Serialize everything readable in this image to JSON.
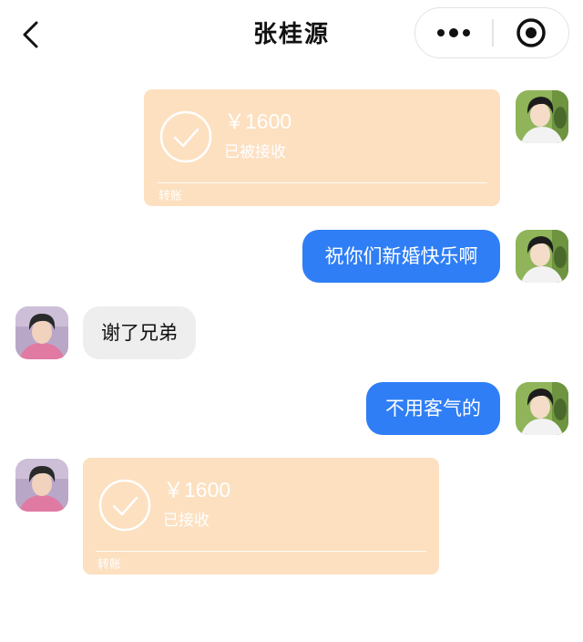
{
  "header": {
    "title": "张桂源",
    "back_icon": "chevron-left-icon",
    "more_icon": "more-dots-icon",
    "close_icon": "target-circle-icon"
  },
  "colors": {
    "sent_bubble": "#2f7ef5",
    "received_bubble": "#eeeeee",
    "transfer_card": "#fce0c0",
    "text_on_card": "#ffffff"
  },
  "messages": [
    {
      "type": "transfer",
      "direction": "sent",
      "amount": "￥1600",
      "status": "已被接收",
      "label": "转账"
    },
    {
      "type": "text",
      "direction": "sent",
      "text": "祝你们新婚快乐啊"
    },
    {
      "type": "text",
      "direction": "received",
      "text": "谢了兄弟"
    },
    {
      "type": "text",
      "direction": "sent",
      "text": "不用客气的"
    },
    {
      "type": "transfer",
      "direction": "received",
      "amount": "￥1600",
      "status": "已接收",
      "label": "转账"
    }
  ]
}
